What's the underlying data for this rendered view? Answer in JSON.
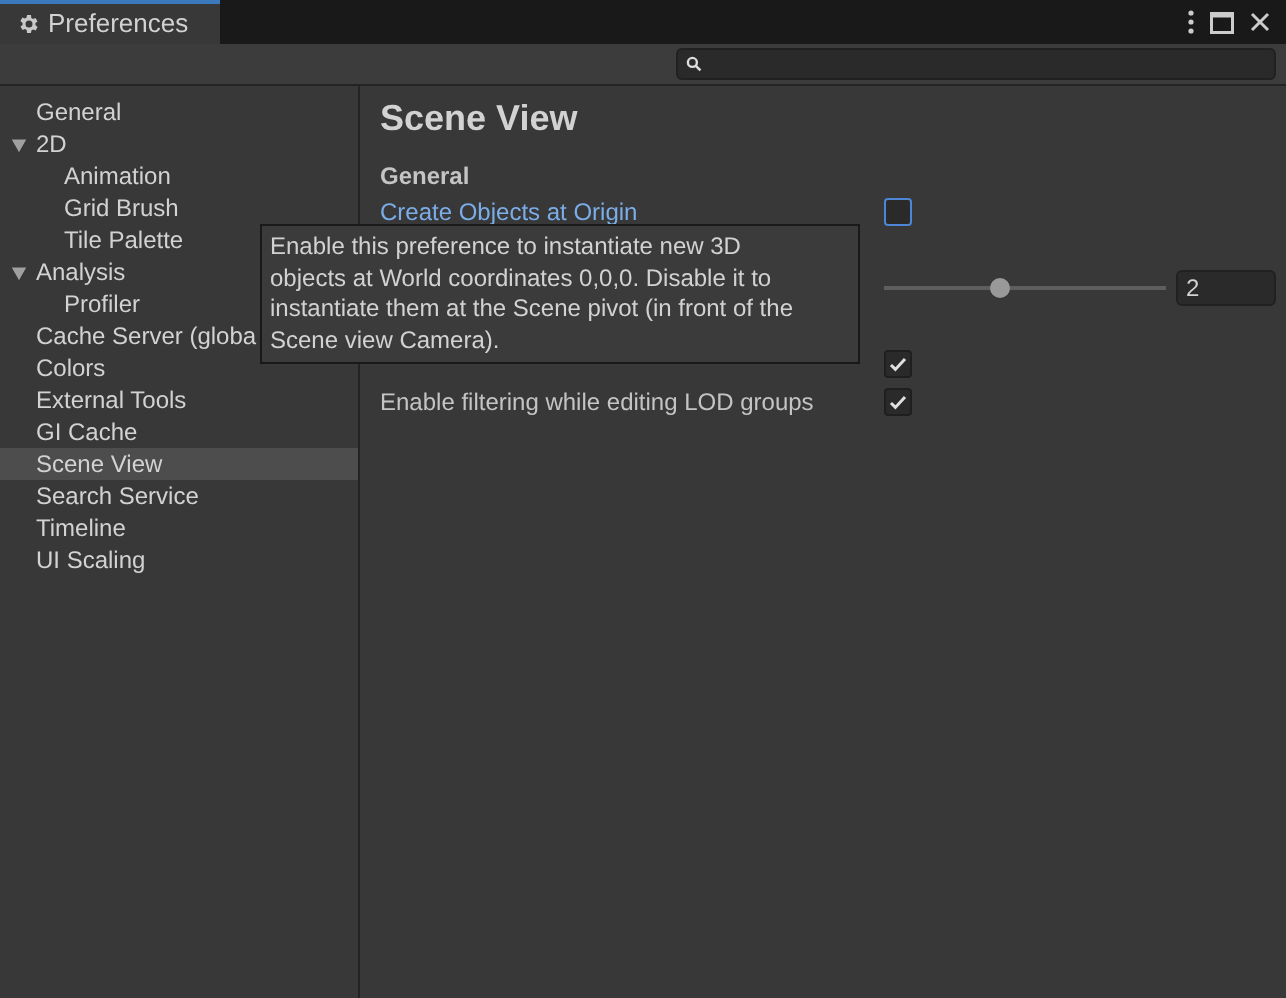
{
  "window": {
    "title": "Preferences"
  },
  "sidebar": {
    "items": [
      {
        "label": "General",
        "selected": false
      },
      {
        "label": "2D",
        "selected": false,
        "expanded": true,
        "children": [
          {
            "label": "Animation",
            "selected": false
          },
          {
            "label": "Grid Brush",
            "selected": false
          },
          {
            "label": "Tile Palette",
            "selected": false
          }
        ]
      },
      {
        "label": "Analysis",
        "selected": false,
        "expanded": true,
        "children": [
          {
            "label": "Profiler",
            "selected": false
          }
        ]
      },
      {
        "label": "Cache Server (globa",
        "selected": false
      },
      {
        "label": "Colors",
        "selected": false
      },
      {
        "label": "External Tools",
        "selected": false
      },
      {
        "label": "GI Cache",
        "selected": false
      },
      {
        "label": "Scene View",
        "selected": true
      },
      {
        "label": "Search Service",
        "selected": false
      },
      {
        "label": "Timeline",
        "selected": false
      },
      {
        "label": "UI Scaling",
        "selected": false
      }
    ]
  },
  "content": {
    "title": "Scene View",
    "section": "General",
    "settings": [
      {
        "kind": "checkbox",
        "label": "Create Objects at Origin",
        "hovered": true,
        "checked": false
      },
      {
        "kind": "slider",
        "level": 0.41,
        "value": "2"
      },
      {
        "kind": "checkbox",
        "checked": true
      },
      {
        "kind": "checkbox",
        "label": "Enable filtering while editing LOD groups",
        "hovered": false,
        "checked": true
      }
    ]
  },
  "tooltip": {
    "text": "Enable this preference to instantiate new 3D objects at World coordinates 0,0,0. Disable it to instantiate them at the Scene pivot (in front of the Scene view Camera)."
  }
}
